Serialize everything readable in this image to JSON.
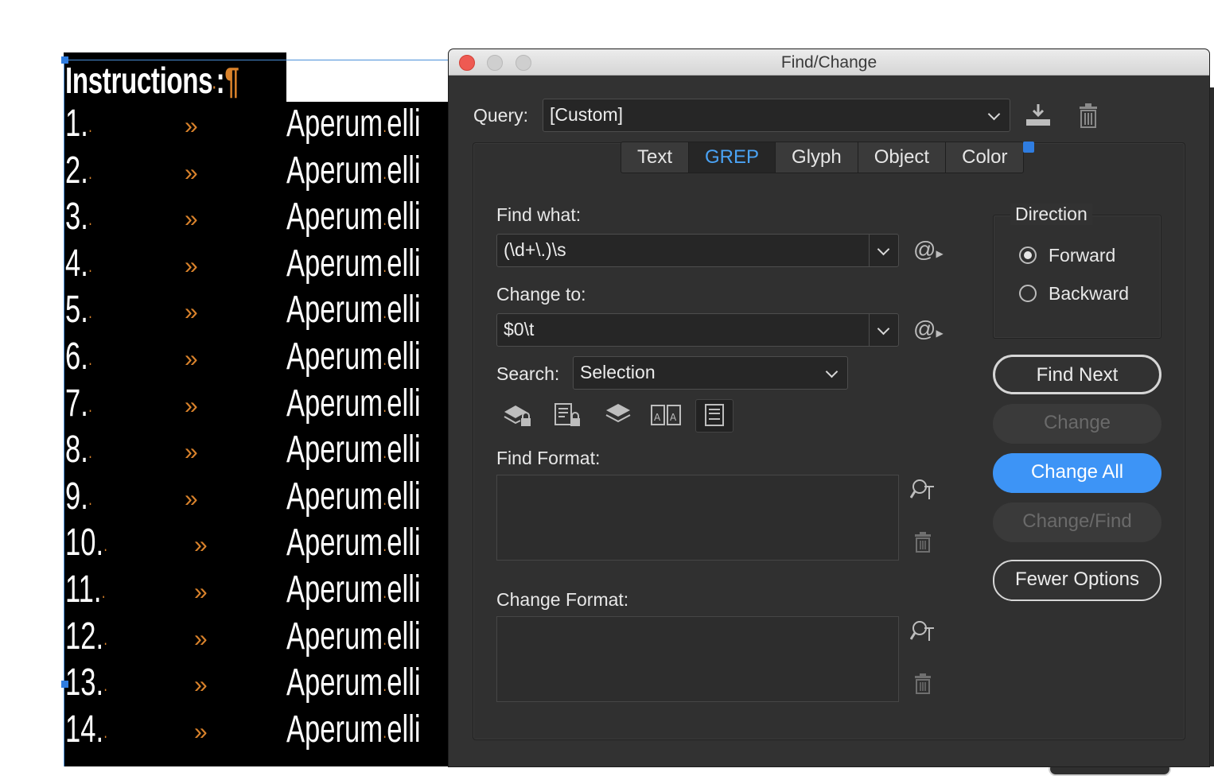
{
  "document": {
    "heading": "Instructions",
    "heading_marker": "¶",
    "tab_glyph": "»",
    "dot_glyph": "·",
    "rows": [
      {
        "num": "1.",
        "text": "Aperum",
        "tail": "elli"
      },
      {
        "num": "2.",
        "text": "Aperum",
        "tail": "elli"
      },
      {
        "num": "3.",
        "text": "Aperum",
        "tail": "elli"
      },
      {
        "num": "4.",
        "text": "Aperum",
        "tail": "elli"
      },
      {
        "num": "5.",
        "text": "Aperum",
        "tail": "elli"
      },
      {
        "num": "6.",
        "text": "Aperum",
        "tail": "elli"
      },
      {
        "num": "7.",
        "text": "Aperum",
        "tail": "elli"
      },
      {
        "num": "8.",
        "text": "Aperum",
        "tail": "elli"
      },
      {
        "num": "9.",
        "text": "Aperum",
        "tail": "elli"
      },
      {
        "num": "10.",
        "text": "Aperum",
        "tail": "elli"
      },
      {
        "num": "11.",
        "text": "Aperum",
        "tail": "elli"
      },
      {
        "num": "12.",
        "text": "Aperum",
        "tail": "elli"
      },
      {
        "num": "13.",
        "text": "Aperum",
        "tail": "elli"
      },
      {
        "num": "14.",
        "text": "Aperum",
        "tail": "elli"
      }
    ]
  },
  "dialog": {
    "title": "Find/Change",
    "query_label": "Query:",
    "query_value": "[Custom]",
    "tabs": [
      "Text",
      "GREP",
      "Glyph",
      "Object",
      "Color"
    ],
    "active_tab": "GREP",
    "find_what_label": "Find what:",
    "find_what_value": "(\\d+\\.)\\s",
    "change_to_label": "Change to:",
    "change_to_value": "$0\\t",
    "special_char_glyph": "@",
    "search_label": "Search:",
    "search_value": "Selection",
    "find_format_label": "Find Format:",
    "change_format_label": "Change Format:",
    "direction_label": "Direction",
    "direction_options": [
      "Forward",
      "Backward"
    ],
    "direction_selected": "Forward",
    "buttons": {
      "find_next": "Find Next",
      "change": "Change",
      "change_all": "Change All",
      "change_find": "Change/Find",
      "fewer_options": "Fewer Options"
    }
  },
  "colors": {
    "accent": "#3d94f6",
    "marker": "#d9822b",
    "dialog_bg": "#323232"
  }
}
